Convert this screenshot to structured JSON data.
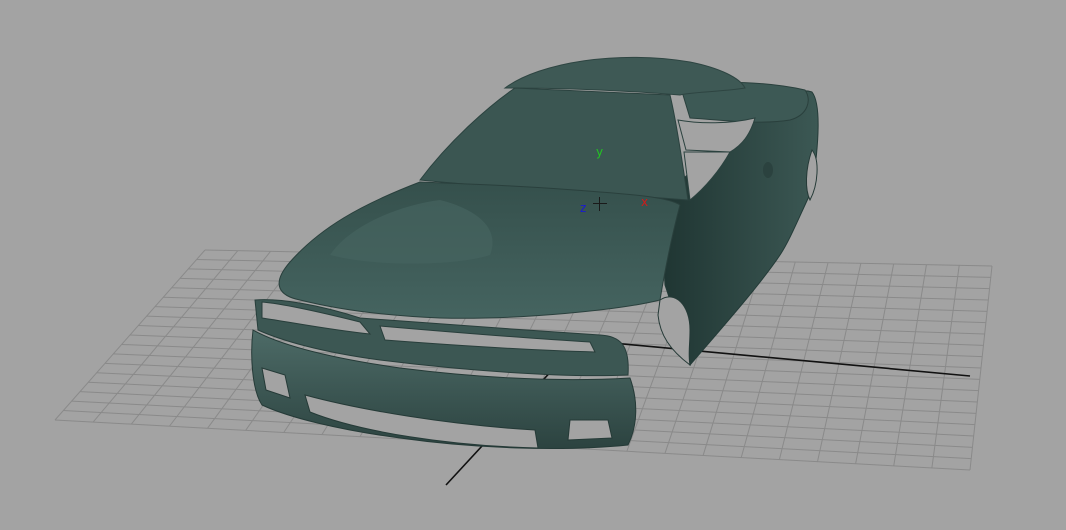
{
  "viewport": {
    "background_color": "#a3a3a3",
    "grid_color": "#8a8a8a",
    "grid_axis_color": "#111111",
    "model_color": "#3f5a56"
  },
  "axes": {
    "y": {
      "label": "y",
      "color": "#22c422"
    },
    "x": {
      "label": "x",
      "color": "#d01a1a"
    },
    "z": {
      "label": "z",
      "color": "#1a1ad0"
    }
  }
}
